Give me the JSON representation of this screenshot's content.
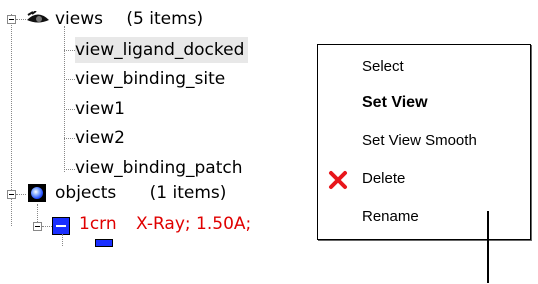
{
  "tree": {
    "views_node": {
      "label": "views",
      "count": "(5 items)"
    },
    "views": [
      "view_ligand_docked",
      "view_binding_site",
      "view1",
      "view2",
      "view_binding_patch"
    ],
    "objects_node": {
      "label": "objects",
      "count": "(1 items)"
    },
    "molecule": {
      "label": "1crn",
      "info": "X-Ray; 1.50A;"
    }
  },
  "context_menu": {
    "items": [
      {
        "label": "Select"
      },
      {
        "label": "Set View"
      },
      {
        "label": "Set View Smooth"
      },
      {
        "label": "Delete"
      },
      {
        "label": "Rename"
      }
    ]
  },
  "colors": {
    "molecule_text": "#e00000",
    "delete_icon": "#e8161b"
  }
}
